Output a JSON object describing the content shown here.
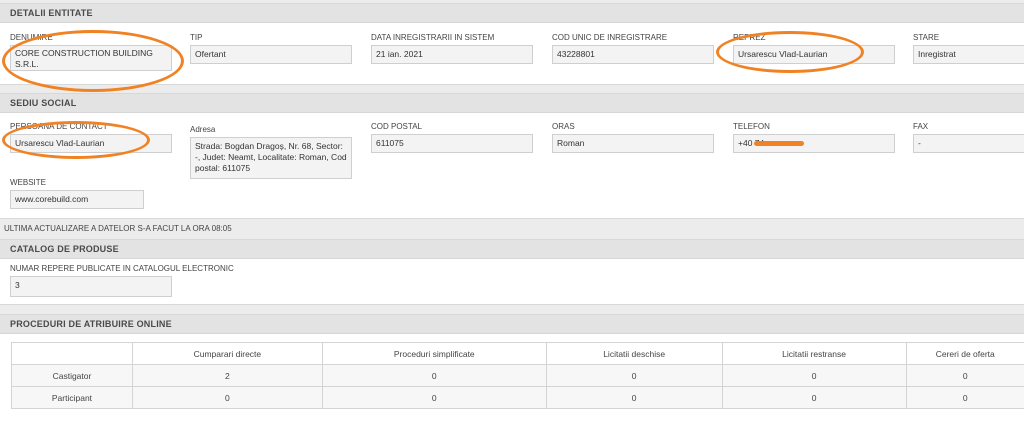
{
  "detalii": {
    "title": "DETALII ENTITATE",
    "denumire": {
      "label": "DENUMIRE",
      "value": "CORE CONSTRUCTION BUILDING S.R.L."
    },
    "tip": {
      "label": "TIP",
      "value": "Ofertant"
    },
    "data_inreg": {
      "label": "DATA INREGISTRARII IN SISTEM",
      "value": "21 ian. 2021"
    },
    "cod_unic": {
      "label": "COD UNIC DE INREGISTRARE",
      "value": "43228801"
    },
    "reprez": {
      "label": "REPREZ",
      "value": "Ursarescu Vlad-Laurian"
    },
    "stare": {
      "label": "STARE",
      "value": "Inregistrat"
    }
  },
  "sediu": {
    "title": "SEDIU SOCIAL",
    "persoana": {
      "label": "PERSOANA DE CONTACT",
      "value": "Ursarescu Vlad-Laurian"
    },
    "adresa": {
      "label": "Adresa",
      "value": "Strada: Bogdan Dragoș, Nr. 68, Sector: -, Judet: Neamt, Localitate: Roman, Cod postal: 611075"
    },
    "cod_postal": {
      "label": "COD POSTAL",
      "value": "611075"
    },
    "oras": {
      "label": "ORAS",
      "value": "Roman"
    },
    "telefon": {
      "label": "TELEFON",
      "value": "+40 74"
    },
    "fax": {
      "label": "FAX",
      "value": "-"
    },
    "website": {
      "label": "WEBSITE",
      "value": "www.corebuild.com"
    }
  },
  "last_update": "ULTIMA ACTUALIZARE A DATELOR S-A FACUT LA ORA 08:05",
  "catalog": {
    "title": "CATALOG DE PRODUSE",
    "numar": {
      "label": "NUMAR REPERE PUBLICATE IN CATALOGUL ELECTRONIC",
      "value": "3"
    }
  },
  "proceduri": {
    "title": "PROCEDURI DE ATRIBUIRE ONLINE",
    "columns": [
      "",
      "Cumparari directe",
      "Proceduri simplificate",
      "Licitatii deschise",
      "Licitatii restranse",
      "Cereri de oferta"
    ],
    "rows": [
      {
        "label": "Castigator",
        "values": [
          "2",
          "0",
          "0",
          "0",
          "0"
        ]
      },
      {
        "label": "Participant",
        "values": [
          "0",
          "0",
          "0",
          "0",
          "0"
        ]
      }
    ]
  },
  "colors": {
    "annotation": "#f08224",
    "header_bg": "#e3e3e3"
  }
}
